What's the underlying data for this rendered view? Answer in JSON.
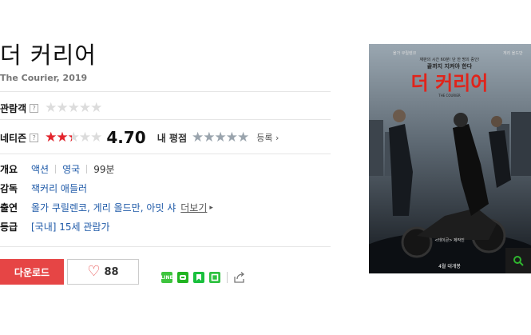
{
  "movie": {
    "title": "더 커리어",
    "subtitle": "The Courier, 2019"
  },
  "ratings": {
    "audience_label": "관람객",
    "audience_help": "?",
    "audience_stars": 0,
    "netizen_label": "네티즌",
    "netizen_help": "?",
    "netizen_score": "4.70",
    "netizen_stars": 0.47,
    "my_rating_label": "내 평점",
    "register_label": "등록",
    "star_glyphs": "★★★★★"
  },
  "info": {
    "overview_label": "개요",
    "genre": "액션",
    "country": "영국",
    "runtime": "99분",
    "director_label": "감독",
    "director": "잭커리 애들러",
    "cast_label": "출연",
    "cast": "올가 쿠릴렌코, 게리 올드만, 아밋 샤",
    "cast_more": "더보기",
    "grade_label": "등급",
    "grade": "[국내] 15세 관람가"
  },
  "actions": {
    "download_label": "다운로드",
    "like_count": "88"
  },
  "share": {
    "icons": [
      "line-icon",
      "band-icon",
      "blog-icon",
      "cafe-icon",
      "share-icon"
    ],
    "line_text": "LINE"
  },
  "poster": {
    "title_text": "더 커리어",
    "english_text": "THE COURIER",
    "top_left_credit": "올가 쿠릴렌코",
    "top_right_credit": "게리 올드만",
    "tagline_1": "재판의 시간 60분! 단 한 명의 증인!",
    "tagline_2": "끝까지 지켜야 한다",
    "release": "4월 대개봉",
    "bottom_credit": "<테이큰> 제작진",
    "accent_color": "#e0241b"
  },
  "colors": {
    "accent": "#e64545",
    "link": "#1f5aa8",
    "star_red": "#e4242c"
  }
}
